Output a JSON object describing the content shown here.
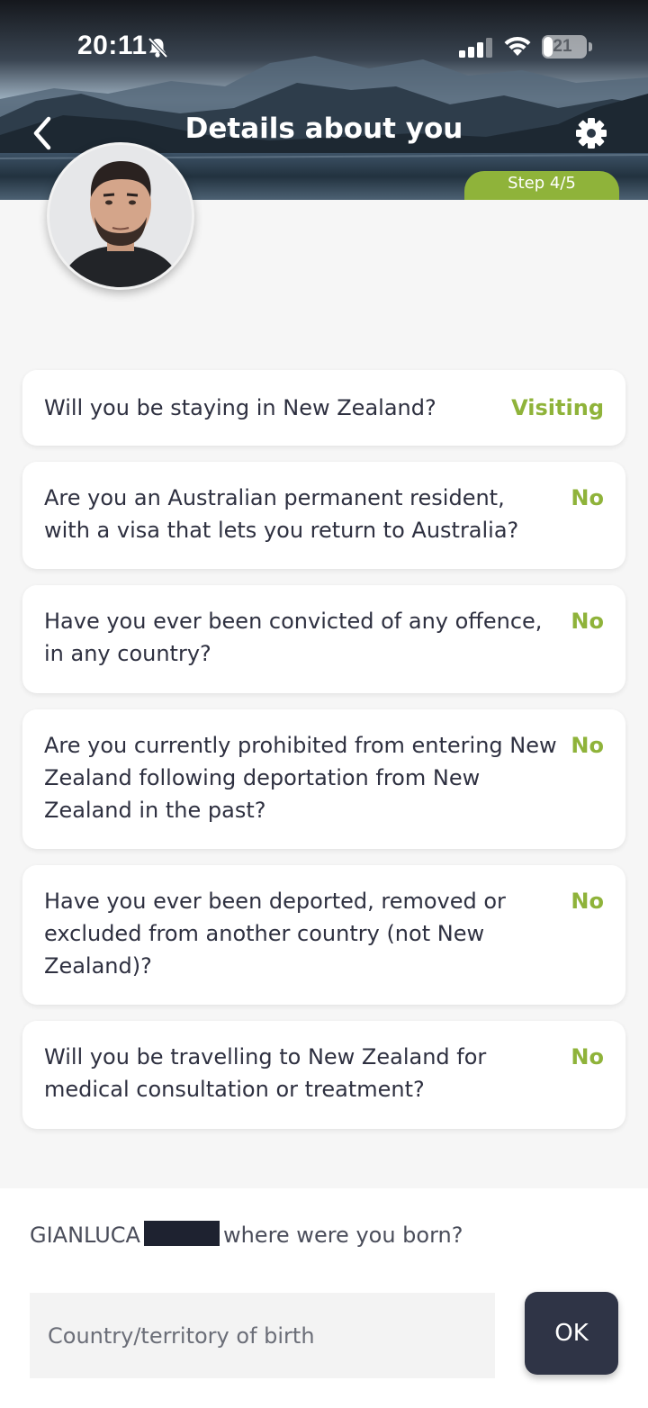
{
  "status_bar": {
    "time": "20:11",
    "battery": "21",
    "battery_fraction": 0.21
  },
  "header": {
    "title": "Details about you",
    "step": "Step 4/5"
  },
  "colors": {
    "accent_green": "#8fb33a",
    "button_dark": "#2f3446"
  },
  "questions": [
    {
      "question": "Will you be staying in New Zealand?",
      "answer": "Visiting"
    },
    {
      "question": "Are you an Australian permanent resident, with a visa that lets you return to Australia?",
      "answer": "No"
    },
    {
      "question": "Have you ever been convicted of any offence, in any country?",
      "answer": "No"
    },
    {
      "question": "Are you currently prohibited from entering New Zealand following deportation from New Zealand in the past?",
      "answer": "No"
    },
    {
      "question": "Have you ever been deported, removed or excluded from another country (not New Zealand)?",
      "answer": "No"
    },
    {
      "question": "Will you be travelling to New Zealand for medical consultation or treatment?",
      "answer": "No"
    }
  ],
  "prompt": {
    "first_name": "GIANLUCA",
    "question": "where were you born?"
  },
  "input": {
    "placeholder": "Country/territory of birth",
    "value": ""
  },
  "ok_label": "OK",
  "icons": {
    "back": "chevron-left-icon",
    "settings": "gear-icon",
    "bell_off": "bell-slash-icon",
    "signal": "cellular-signal-icon",
    "wifi": "wifi-icon"
  }
}
